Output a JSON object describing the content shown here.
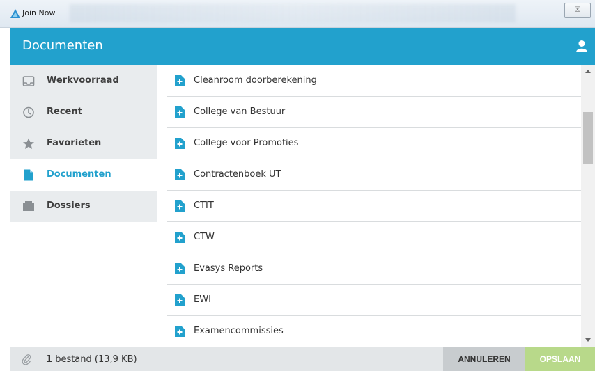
{
  "window": {
    "title": "Join Now",
    "close_glyph": "☒"
  },
  "header": {
    "title": "Documenten",
    "user_icon": "user-icon"
  },
  "sidebar": {
    "items": [
      {
        "label": "Werkvoorraad",
        "icon": "inbox-icon"
      },
      {
        "label": "Recent",
        "icon": "clock-icon"
      },
      {
        "label": "Favorieten",
        "icon": "star-icon"
      },
      {
        "label": "Documenten",
        "icon": "document-icon",
        "active": true
      },
      {
        "label": "Dossiers",
        "icon": "folder-icon"
      }
    ]
  },
  "list": {
    "items": [
      "Cleanroom doorberekening",
      "College van Bestuur",
      "College voor Promoties",
      "Contractenboek UT",
      "CTIT",
      "CTW",
      "Evasys Reports",
      "EWI",
      "Examencommissies"
    ]
  },
  "footer": {
    "count": "1",
    "file_text": "bestand (13,9 KB)",
    "cancel_label": "ANNULEREN",
    "save_label": "OPSLAAN"
  },
  "colors": {
    "accent": "#22a1cd",
    "save_disabled": "#b8d98a",
    "cancel": "#c8cccf"
  }
}
